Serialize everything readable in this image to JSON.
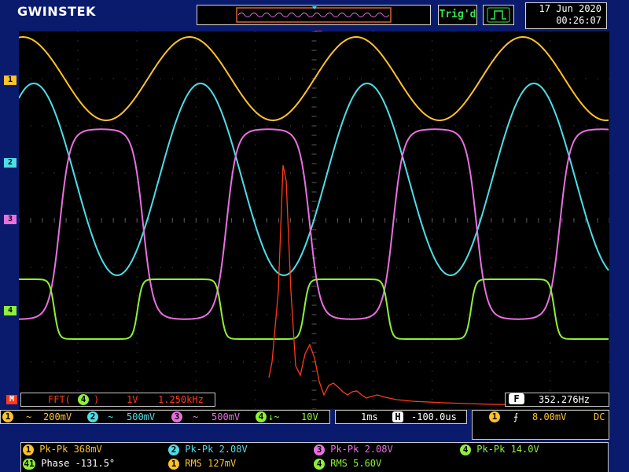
{
  "header": {
    "logo": "GWINSTEK",
    "trigger_status": "Trig'd",
    "date": "17 Jun 2020",
    "time": "00:26:07"
  },
  "channel_markers": {
    "ch1": "1",
    "ch2": "2",
    "ch3": "3",
    "ch4": "4",
    "math": "M"
  },
  "math_bar": {
    "label": "FFT(",
    "source": "4",
    "close": ")",
    "scale": "1V",
    "freq_scale": "1.250kHz",
    "counter_icon": "F",
    "counter": "352.276Hz"
  },
  "channels_bar": {
    "ch1": {
      "num": "1",
      "coupling": "~",
      "scale": "200mV"
    },
    "ch2": {
      "num": "2",
      "coupling": "~",
      "scale": "500mV"
    },
    "ch3": {
      "num": "3",
      "coupling": "~",
      "scale": "500mV"
    },
    "ch4": {
      "num": "4",
      "coupling": "↓~",
      "scale": "10V"
    },
    "timebase": "1ms",
    "position_icon": "H",
    "position": "-100.0us",
    "trigger": {
      "source": "1",
      "slope": "⨍",
      "level": "8.00mV",
      "coupling": "DC"
    }
  },
  "measurements": [
    {
      "ch": "1",
      "label": "Pk-Pk 368mV",
      "color": "#ffc22b"
    },
    {
      "ch": "2",
      "label": "Pk-Pk 2.08V",
      "color": "#4fdde8"
    },
    {
      "ch": "3",
      "label": "Pk-Pk 2.08V",
      "color": "#e870e0"
    },
    {
      "ch": "4",
      "label": "Pk-Pk 14.0V",
      "color": "#8ef03a"
    },
    {
      "ch": "41",
      "label": "Phase -131.5°",
      "color": "#ffffff"
    },
    {
      "ch": "1",
      "label": "RMS 127mV",
      "color": "#ffc22b"
    },
    {
      "ch": "4",
      "label": "RMS 5.60V",
      "color": "#8ef03a"
    }
  ],
  "colors": {
    "ch1": "#ffc22b",
    "ch2": "#4fdde8",
    "ch3": "#e870e0",
    "ch4": "#8ef03a",
    "math": "#ff3a1a",
    "grid": "#5a5a5a",
    "bg": "#0a1b6e"
  }
}
